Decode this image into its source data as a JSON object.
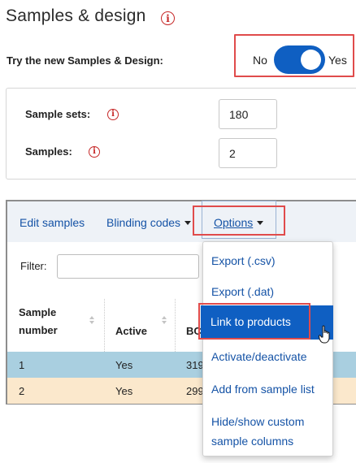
{
  "header": {
    "title": "Samples & design",
    "info_icon": "info-icon"
  },
  "toggle_row": {
    "label": "Try the new Samples & Design:",
    "off_label": "No",
    "on_label": "Yes",
    "state": "on",
    "accent": "#0f5fc2"
  },
  "sample_fields": [
    {
      "label": "Sample sets:",
      "value": "180"
    },
    {
      "label": "Samples:",
      "value": "2"
    }
  ],
  "toolbar": {
    "edit_samples": "Edit samples",
    "blinding_codes": "Blinding codes",
    "options": "Options"
  },
  "filter": {
    "label": "Filter:",
    "value": ""
  },
  "table": {
    "columns": [
      "Sample number",
      "Active",
      "BC"
    ],
    "col1_line1": "Sample",
    "col1_line2": "number",
    "rows": [
      {
        "number": "1",
        "active": "Yes",
        "bc": "319"
      },
      {
        "number": "2",
        "active": "Yes",
        "bc": "299"
      }
    ],
    "row_colors": [
      "#a9cfe0",
      "#fbe8cc"
    ]
  },
  "options_menu": {
    "items": [
      "Export (.csv)",
      "Export (.dat)",
      "Link to products",
      "Activate/deactivate",
      "Add from sample list"
    ],
    "last_item_line1": "Hide/show custom",
    "last_item_line2": "sample columns",
    "highlighted": "Link to products"
  },
  "colors": {
    "highlight_red": "#e04b4b",
    "link_blue": "#1553a6"
  }
}
